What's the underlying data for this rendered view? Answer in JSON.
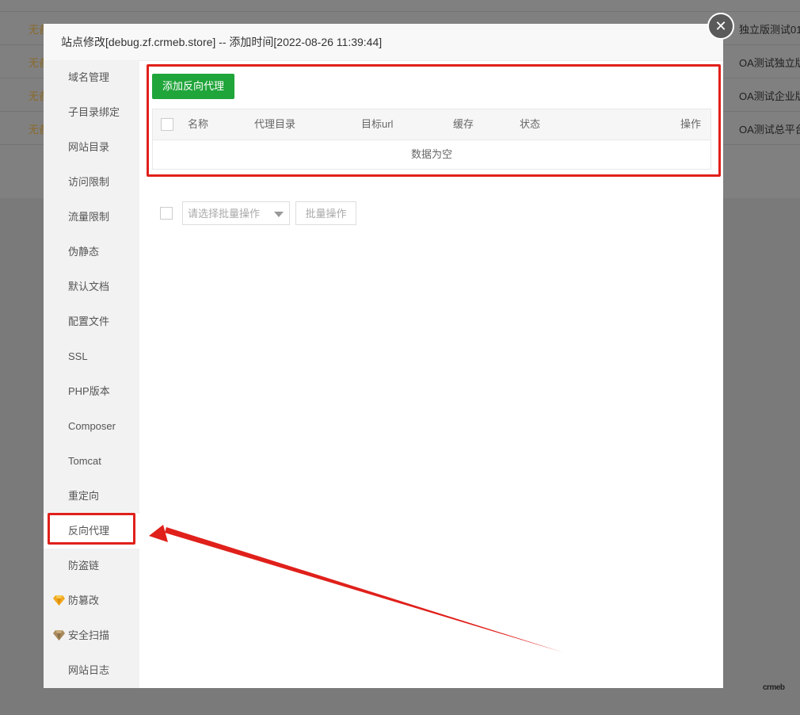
{
  "background": {
    "rows": [
      {
        "warn": "无备",
        "right": "独立版测试01"
      },
      {
        "warn": "无备",
        "right": "OA测试独立版"
      },
      {
        "warn": "无备",
        "right": "OA测试企业版"
      },
      {
        "warn": "无备",
        "right": "OA测试总平台"
      }
    ]
  },
  "modal": {
    "title": "站点修改[debug.zf.crmeb.store] -- 添加时间[2022-08-26 11:39:44]",
    "close_icon": "close-icon"
  },
  "sidebar": {
    "items": [
      {
        "label": "域名管理"
      },
      {
        "label": "子目录绑定"
      },
      {
        "label": "网站目录"
      },
      {
        "label": "访问限制"
      },
      {
        "label": "流量限制"
      },
      {
        "label": "伪静态"
      },
      {
        "label": "默认文档"
      },
      {
        "label": "配置文件"
      },
      {
        "label": "SSL"
      },
      {
        "label": "PHP版本"
      },
      {
        "label": "Composer"
      },
      {
        "label": "Tomcat"
      },
      {
        "label": "重定向"
      },
      {
        "label": "反向代理",
        "active": true
      },
      {
        "label": "防盗链"
      },
      {
        "label": "防篡改",
        "icon": "diamond-icon"
      },
      {
        "label": "安全扫描",
        "icon": "diamond-icon"
      },
      {
        "label": "网站日志"
      }
    ]
  },
  "content": {
    "add_button": "添加反向代理",
    "table": {
      "headers": [
        "名称",
        "代理目录",
        "目标url",
        "缓存",
        "状态",
        "操作"
      ],
      "empty_text": "数据为空"
    },
    "batch": {
      "placeholder": "请选择批量操作",
      "button": "批量操作"
    }
  },
  "colors": {
    "accent_green": "#20a53a",
    "annotation_red": "#e0201b",
    "gem_gold": "#f0a81e"
  },
  "watermark": "crmeb"
}
